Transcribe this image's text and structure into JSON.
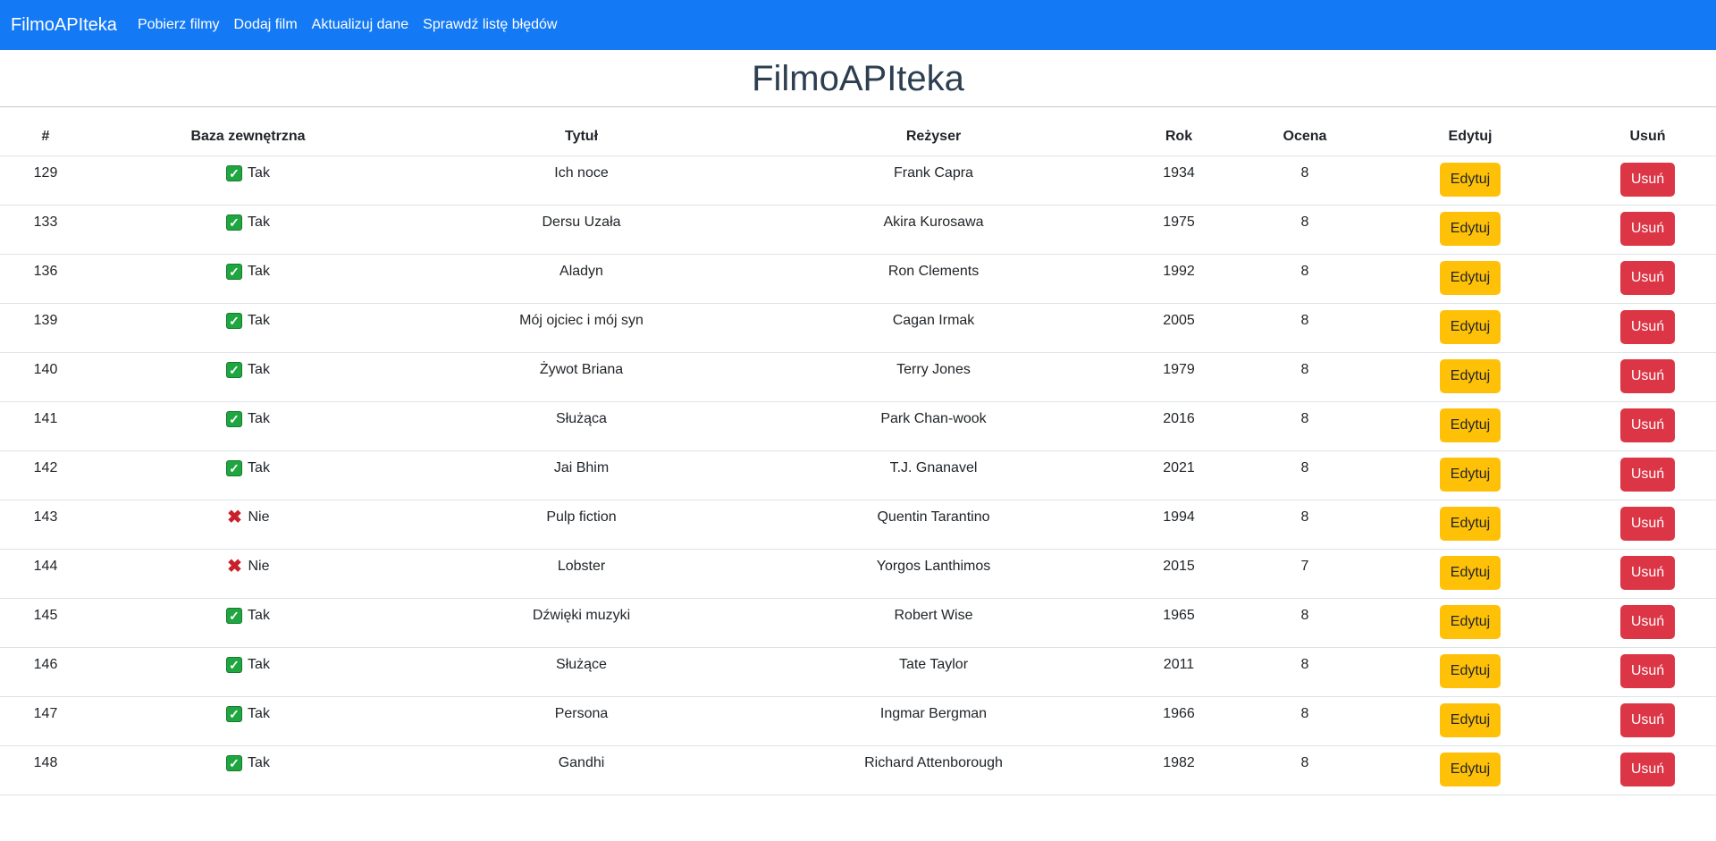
{
  "nav": {
    "brand": "FilmoAPIteka",
    "links": [
      "Pobierz filmy",
      "Dodaj film",
      "Aktualizuj dane",
      "Sprawdź listę błędów"
    ]
  },
  "page_title": "FilmoAPIteka",
  "table": {
    "headers": [
      "#",
      "Baza zewnętrzna",
      "Tytuł",
      "Reżyser",
      "Rok",
      "Ocena",
      "Edytuj",
      "Usuń"
    ],
    "edit_label": "Edytuj",
    "delete_label": "Usuń",
    "rows": [
      {
        "id": "129",
        "external": true,
        "external_label": "Tak",
        "title": "Ich noce",
        "director": "Frank Capra",
        "year": "1934",
        "rating": "8"
      },
      {
        "id": "133",
        "external": true,
        "external_label": "Tak",
        "title": "Dersu Uzała",
        "director": "Akira Kurosawa",
        "year": "1975",
        "rating": "8"
      },
      {
        "id": "136",
        "external": true,
        "external_label": "Tak",
        "title": "Aladyn",
        "director": "Ron Clements",
        "year": "1992",
        "rating": "8"
      },
      {
        "id": "139",
        "external": true,
        "external_label": "Tak",
        "title": "Mój ojciec i mój syn",
        "director": "Cagan Irmak",
        "year": "2005",
        "rating": "8"
      },
      {
        "id": "140",
        "external": true,
        "external_label": "Tak",
        "title": "Żywot Briana",
        "director": "Terry Jones",
        "year": "1979",
        "rating": "8"
      },
      {
        "id": "141",
        "external": true,
        "external_label": "Tak",
        "title": "Służąca",
        "director": "Park Chan-wook",
        "year": "2016",
        "rating": "8"
      },
      {
        "id": "142",
        "external": true,
        "external_label": "Tak",
        "title": "Jai Bhim",
        "director": "T.J. Gnanavel",
        "year": "2021",
        "rating": "8"
      },
      {
        "id": "143",
        "external": false,
        "external_label": "Nie",
        "title": "Pulp fiction",
        "director": "Quentin Tarantino",
        "year": "1994",
        "rating": "8"
      },
      {
        "id": "144",
        "external": false,
        "external_label": "Nie",
        "title": "Lobster",
        "director": "Yorgos Lanthimos",
        "year": "2015",
        "rating": "7"
      },
      {
        "id": "145",
        "external": true,
        "external_label": "Tak",
        "title": "Dźwięki muzyki",
        "director": "Robert Wise",
        "year": "1965",
        "rating": "8"
      },
      {
        "id": "146",
        "external": true,
        "external_label": "Tak",
        "title": "Służące",
        "director": "Tate Taylor",
        "year": "2011",
        "rating": "8"
      },
      {
        "id": "147",
        "external": true,
        "external_label": "Tak",
        "title": "Persona",
        "director": "Ingmar Bergman",
        "year": "1966",
        "rating": "8"
      },
      {
        "id": "148",
        "external": true,
        "external_label": "Tak",
        "title": "Gandhi",
        "director": "Richard Attenborough",
        "year": "1982",
        "rating": "8"
      }
    ]
  },
  "icons": {
    "yes": "check-mark-icon",
    "no": "cross-mark-icon"
  },
  "colors": {
    "navbar": "#1479f5",
    "edit": "#ffc107",
    "delete": "#dc3545",
    "check": "#1fa640",
    "cross": "#c8202a"
  }
}
